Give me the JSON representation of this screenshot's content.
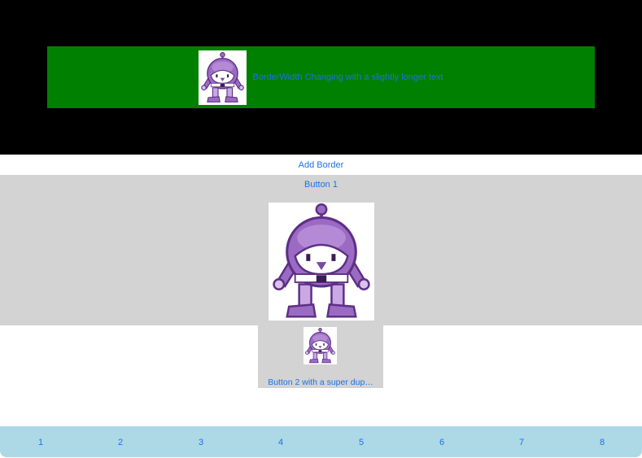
{
  "top_button": {
    "label": "BorderWidth Changing with a slightly longer text"
  },
  "add_border_label": "Add Border",
  "button1_label": "Button 1",
  "button2_label": "Button 2 with a super dup…",
  "tabs": [
    "1",
    "2",
    "3",
    "4",
    "5",
    "6",
    "7",
    "8"
  ],
  "colors": {
    "top_bg": "#000000",
    "green_button": "#008000",
    "link_blue": "#1a73e8",
    "grey_panel": "#d3d3d3",
    "tab_bar": "#add8e6"
  },
  "icons": {
    "robot": "robot-mascot-icon"
  }
}
